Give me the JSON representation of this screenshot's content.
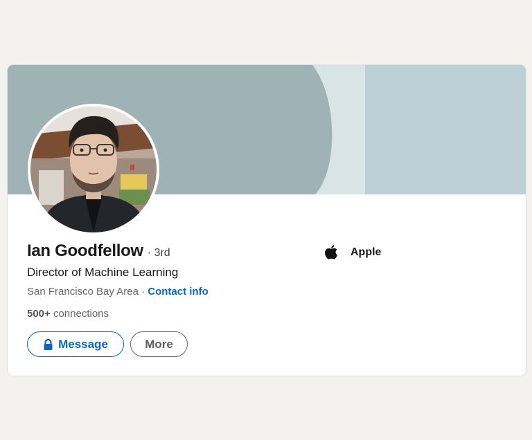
{
  "profile": {
    "name": "Ian Goodfellow",
    "degree": "· 3rd",
    "headline": "Director of Machine Learning",
    "location": "San Francisco Bay Area",
    "separator": " · ",
    "contact_info": "Contact info",
    "connections_count": "500+",
    "connections_label": " connections"
  },
  "company": {
    "name": "Apple",
    "icon": "apple-logo-icon"
  },
  "actions": {
    "message_label": "Message",
    "message_icon": "lock-icon",
    "more_label": "More"
  },
  "colors": {
    "page_background": "#f3f2ef",
    "banner_dark": "#9fb3b7",
    "banner_light": "#bcd0d5",
    "banner_stripe": "#d8e4e6",
    "link_blue": "#0a66c2",
    "text_primary": "#191919",
    "text_secondary": "#666666"
  }
}
